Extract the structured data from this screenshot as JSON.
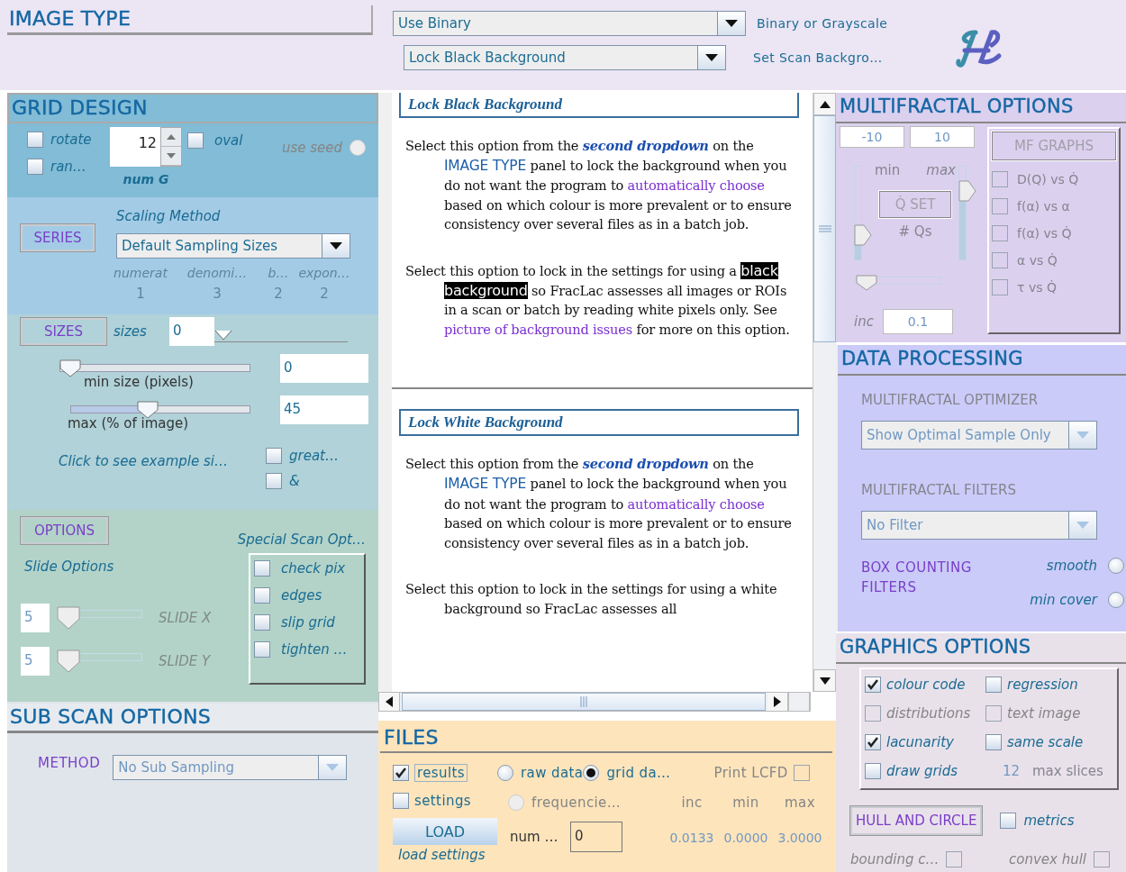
{
  "image_type": {
    "title": "IMAGE TYPE",
    "dropdowns": [
      {
        "value": "Use Binary",
        "label": "Binary or Grayscale"
      },
      {
        "value": "Lock Black Background",
        "label": "Set Scan Backgro…"
      }
    ]
  },
  "grid_design": {
    "title": "GRID DESIGN",
    "checks": [
      {
        "label": "rotate",
        "checked": false
      },
      {
        "label": "ran…",
        "checked": false
      }
    ],
    "num_grids": {
      "value": "12",
      "label": "num G"
    },
    "oval": {
      "label": "oval",
      "checked": false
    },
    "use_seed": {
      "label": "use seed",
      "selected": false,
      "disabled": true
    }
  },
  "series": {
    "button": "SERIES",
    "scaling_label": "Scaling Method",
    "dropdown": "Default Sampling Sizes",
    "columns": [
      {
        "heading": "numerat",
        "value": "1"
      },
      {
        "heading": "denomi…",
        "value": "3"
      },
      {
        "heading": "b…",
        "value": "2"
      },
      {
        "heading": "expon…",
        "value": "2"
      }
    ]
  },
  "sizes": {
    "button": "SIZES",
    "sizes_label": "sizes",
    "sizes_value": "0",
    "sizes_slider": {
      "level": 0
    },
    "sliders": [
      {
        "label": "min size (pixels)",
        "level": 0,
        "value": "0"
      },
      {
        "label": "max (% of image)",
        "level": 0.42,
        "value": "45"
      }
    ],
    "example_label": "Click to see example si…",
    "checks": [
      {
        "label": "great…",
        "checked": false
      },
      {
        "label": "&",
        "checked": false
      }
    ]
  },
  "options": {
    "button": "OPTIONS",
    "special_label": "Special Scan Opt…",
    "slide_label": "Slide Options",
    "slides": [
      {
        "value": "5",
        "label": "SLIDE X",
        "level": 0
      },
      {
        "value": "5",
        "label": "SLIDE Y",
        "level": 0
      }
    ],
    "special_checks": [
      {
        "label": "check pix",
        "checked": false
      },
      {
        "label": "edges",
        "checked": false
      },
      {
        "label": "slip grid",
        "checked": false
      },
      {
        "label": "tighten …",
        "checked": false
      }
    ]
  },
  "sub_scan": {
    "title": "SUB SCAN OPTIONS",
    "method_label": "METHOD",
    "dropdown": "No Sub Sampling",
    "disabled": true
  },
  "help": {
    "sections": [
      {
        "heading": "Lock Black Background",
        "paragraphs": [
          [
            {
              "kind": "text",
              "text": "Select this option from the "
            },
            {
              "kind": "strong",
              "text": "second dropdown"
            },
            {
              "kind": "text",
              "text": " on the "
            },
            {
              "kind": "term",
              "text": "IMAGE TYPE"
            },
            {
              "kind": "text",
              "text": " panel to lock the background when you do not want the program to "
            },
            {
              "kind": "link",
              "text": "automatically choose"
            },
            {
              "kind": "text",
              "text": " based on which colour is more prevalent or to ensure consistency over several files as in a batch job."
            }
          ],
          [
            {
              "kind": "text",
              "text": "Select this option to lock in the settings for using a "
            },
            {
              "kind": "selected",
              "text": "black background"
            },
            {
              "kind": "text",
              "text": " so FracLac assesses all images or ROIs in a scan or batch by reading white pixels only. See "
            },
            {
              "kind": "link",
              "text": "picture of background issues"
            },
            {
              "kind": "text",
              "text": " for more on this option."
            }
          ]
        ]
      },
      {
        "heading": "Lock White Background",
        "paragraphs": [
          [
            {
              "kind": "text",
              "text": "Select this option from the "
            },
            {
              "kind": "strong",
              "text": "second dropdown"
            },
            {
              "kind": "text",
              "text": " on the "
            },
            {
              "kind": "term",
              "text": "IMAGE TYPE"
            },
            {
              "kind": "text",
              "text": " panel to lock the background when you do not want the program to "
            },
            {
              "kind": "link",
              "text": "automatically choose"
            },
            {
              "kind": "text",
              "text": " based on which colour is more prevalent or to ensure consistency over several files as in a batch job."
            }
          ],
          [
            {
              "kind": "text",
              "text": "Select this option to lock in the settings for using a white background so FracLac assesses all"
            }
          ]
        ]
      }
    ]
  },
  "files": {
    "title": "FILES",
    "checks": [
      {
        "label": "results",
        "checked": true
      },
      {
        "label": "settings",
        "checked": false
      }
    ],
    "radios": [
      {
        "label": "raw data",
        "selected": false,
        "disabled": false
      },
      {
        "label": "grid da…",
        "selected": true,
        "disabled": false
      },
      {
        "label": "frequencie…",
        "selected": false,
        "disabled": true
      }
    ],
    "print_lcfd": {
      "label": "Print LCFD",
      "checked": false
    },
    "load_button": "LOAD",
    "load_label": "load settings",
    "num": {
      "label": "num …",
      "value": "0"
    },
    "stats": [
      {
        "label": "inc",
        "value": "0.0133"
      },
      {
        "label": "min",
        "value": "0.0000"
      },
      {
        "label": "max",
        "value": "3.0000"
      }
    ]
  },
  "multifractal": {
    "title": "MULTIFRACTAL OPTIONS",
    "q_min": "-10",
    "q_max": "10",
    "min_label": "min",
    "max_label": "max",
    "min_slider": {
      "level": 0.2
    },
    "max_slider": {
      "level": 0.8
    },
    "q_set": "Q̇ SET",
    "qs_label": "# Qs",
    "qs_slider": {
      "level": 0
    },
    "inc_label": "inc",
    "inc_value": "0.1",
    "graphs_button": "MF GRAPHS",
    "graphs": [
      {
        "label": "D(Q) vs Q̇",
        "checked": false
      },
      {
        "label": "f(α) vs α",
        "checked": false
      },
      {
        "label": "f(α) vs Q̇",
        "checked": false
      },
      {
        "label": "α vs Q̇",
        "checked": false
      },
      {
        "label": "τ vs Q̇",
        "checked": false
      }
    ]
  },
  "data_processing": {
    "title": "DATA PROCESSING",
    "optimizer_label": "MULTIFRACTAL OPTIMIZER",
    "optimizer": "Show Optimal Sample Only",
    "filters_label": "MULTIFRACTAL FILTERS",
    "filter": "No Filter",
    "box_label": "BOX COUNTING FILTERS",
    "radios": [
      {
        "label": "smooth",
        "selected": false
      },
      {
        "label": "min cover",
        "selected": false
      }
    ]
  },
  "graphics": {
    "title": "GRAPHICS OPTIONS",
    "checks": [
      {
        "label": "colour code",
        "checked": true,
        "disabled": false
      },
      {
        "label": "regression",
        "checked": false,
        "disabled": false
      },
      {
        "label": "distributions",
        "checked": false,
        "disabled": true
      },
      {
        "label": "text image",
        "checked": false,
        "disabled": true
      },
      {
        "label": "lacunarity",
        "checked": true,
        "disabled": false
      },
      {
        "label": "same scale",
        "checked": false,
        "disabled": false
      },
      {
        "label": "draw grids",
        "checked": false,
        "disabled": false
      }
    ],
    "max_slices": {
      "value": "12",
      "label": "max slices"
    },
    "hull_button": "HULL AND CIRCLE",
    "metrics": {
      "label": "metrics",
      "checked": false
    },
    "bottom_checks": [
      {
        "label": "bounding c…",
        "checked": false
      },
      {
        "label": "convex hull",
        "checked": false
      }
    ]
  }
}
